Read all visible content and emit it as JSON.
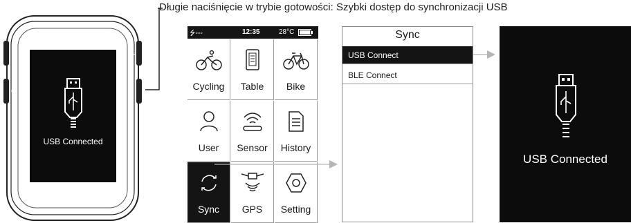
{
  "callout": "Długie naciśnięcie w trybie gotowości: Szybki dostęp do synchronizacji USB",
  "device": {
    "screen_label": "USB Connected"
  },
  "status_bar": {
    "signal": "⭍◦◦◦",
    "time": "12:35",
    "temp": "28°C"
  },
  "menu": [
    {
      "label": "Cycling",
      "icon": "cycling-icon"
    },
    {
      "label": "Table",
      "icon": "table-icon"
    },
    {
      "label": "Bike",
      "icon": "bike-icon"
    },
    {
      "label": "User",
      "icon": "user-icon"
    },
    {
      "label": "Sensor",
      "icon": "sensor-icon"
    },
    {
      "label": "History",
      "icon": "history-icon"
    },
    {
      "label": "Sync",
      "icon": "sync-icon",
      "selected": true
    },
    {
      "label": "GPS",
      "icon": "gps-icon"
    },
    {
      "label": "Setting",
      "icon": "setting-icon"
    }
  ],
  "sync_menu": {
    "title": "Sync",
    "items": [
      "USB Connect",
      "BLE Connect"
    ],
    "selected_index": 0
  },
  "result_screen": {
    "label": "USB Connected"
  },
  "colors": {
    "dark": "#0c0c0c",
    "arrow": "#b5b5b5"
  }
}
